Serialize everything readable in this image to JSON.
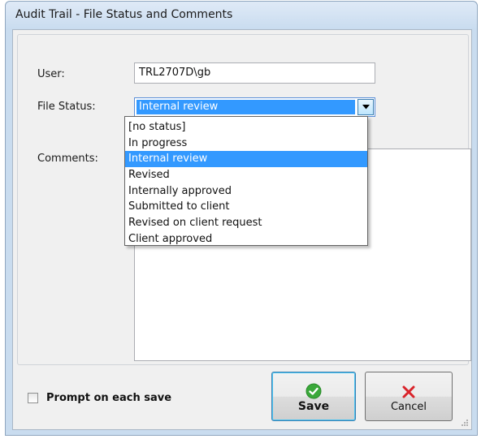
{
  "window": {
    "title": "Audit Trail - File Status and Comments"
  },
  "form": {
    "user_label": "User:",
    "user_value": "TRL2707D\\gb",
    "file_status_label": "File Status:",
    "file_status_value": "Internal review",
    "comments_label": "Comments:",
    "comments_value": ""
  },
  "dropdown": {
    "options": [
      "[no status]",
      "In progress",
      "Internal review",
      "Revised",
      "Internally approved",
      "Submitted to client",
      "Revised on client request",
      "Client approved"
    ],
    "selected_index": 2
  },
  "footer": {
    "prompt_label": "Prompt on each save",
    "prompt_checked": false,
    "save_label": "Save",
    "cancel_label": "Cancel"
  },
  "colors": {
    "selection": "#3399ff",
    "save_icon": "#3aa83a",
    "cancel_icon": "#d9232a"
  },
  "icons": {
    "save": "checkmark-circle-icon",
    "cancel": "x-icon",
    "combo": "chevron-down-icon",
    "grip": "resize-grip-icon"
  }
}
